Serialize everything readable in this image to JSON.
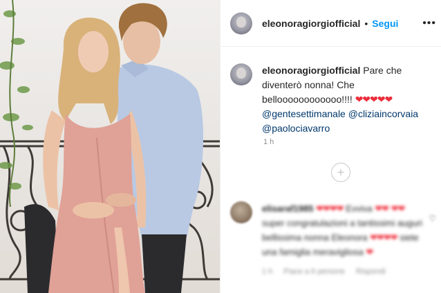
{
  "post": {
    "image_alt": "Photo of a couple in front of a wrought-iron balcony"
  },
  "header": {
    "username": "eleonoragiorgiofficial",
    "separator": "•",
    "follow_label": "Segui",
    "more_icon": "more-options-icon"
  },
  "caption": {
    "username": "eleonoragiorgiofficial",
    "text_line": "Pare che diventerò nonna! Che belloooooooooooo!!!!",
    "hearts": "❤❤❤❤❤",
    "mentions": [
      "@gentesettimanale",
      "@cliziaincorvaia",
      "@paolociavarro"
    ],
    "time": "1 h"
  },
  "load_more": {
    "icon": "plus-circle-icon",
    "glyph": "+"
  },
  "comment": {
    "username": "elisaraf1985",
    "hearts_a": "❤❤❤❤",
    "word_a": "Evviva",
    "hearts_b": "❤❤",
    "hearts_c": "❤❤",
    "text_b": "super congratulazioni a tantissimi auguri bellissima nonna Eleonora",
    "hearts_d": "❤❤❤❤",
    "text_c": "siete una famiglia meravigliosa",
    "hearts_e": "❤",
    "meta": {
      "time": "1 h",
      "likes": "Piace a 6 persone",
      "reply": "Rispondi"
    },
    "like_icon": "heart-outline-icon"
  },
  "colors": {
    "follow": "#0095f6",
    "mention": "#00376b",
    "heart": "#ed2d3a",
    "muted": "#8e8e8e",
    "border": "#efefef"
  }
}
